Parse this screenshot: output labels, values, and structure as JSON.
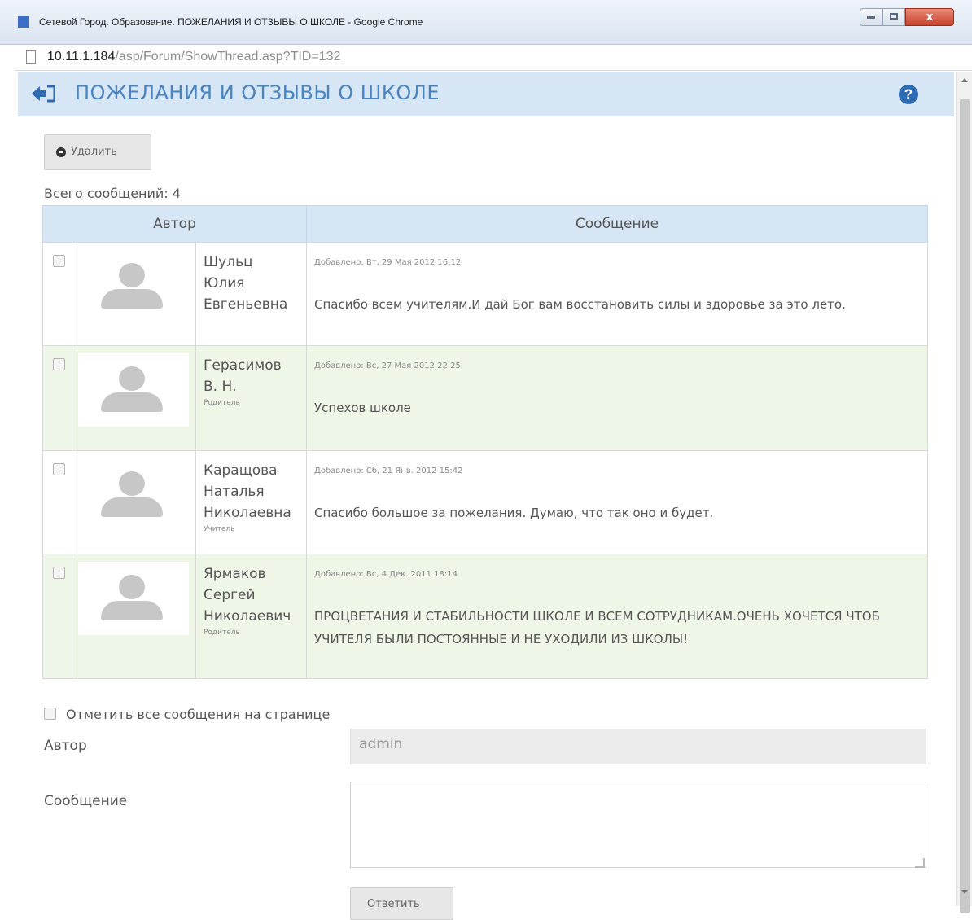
{
  "window": {
    "title": "Сетевой Город. Образование. ПОЖЕЛАНИЯ И ОТЗЫВЫ О ШКОЛЕ - Google Chrome",
    "close_label": "x"
  },
  "address": {
    "host": "10.11.1.184",
    "path": "/asp/Forum/ShowThread.asp?TID=132"
  },
  "header": {
    "title": "ПОЖЕЛАНИЯ И ОТЗЫВЫ О ШКОЛЕ",
    "help_label": "?"
  },
  "toolbar": {
    "delete_label": "Удалить"
  },
  "summary": {
    "total_label": "Всего сообщений: 4"
  },
  "table": {
    "columns": [
      "Автор",
      "Сообщение"
    ],
    "rows": [
      {
        "name_lines": [
          "Шульц",
          "Юлия",
          "Евгеньевна"
        ],
        "role": "",
        "date": "Добавлено: Вт, 29 Мая 2012 16:12",
        "message": "Спасибо всем учителям.И дай Бог вам восстановить силы и здоровье за это лето."
      },
      {
        "name_lines": [
          "Герасимов",
          "В. Н."
        ],
        "role": "Родитель",
        "date": "Добавлено: Вс, 27 Мая 2012 22:25",
        "message": "Успехов школе"
      },
      {
        "name_lines": [
          "Каращова",
          "Наталья",
          "Николаевна"
        ],
        "role": "Учитель",
        "date": "Добавлено: Сб, 21 Янв. 2012 15:42",
        "message": "Спасибо большое за пожелания. Думаю, что так оно и будет."
      },
      {
        "name_lines": [
          "Ярмаков",
          "Сергей",
          "Николаевич"
        ],
        "role": "Родитель",
        "date": "Добавлено: Вс, 4 Дек. 2011 18:14",
        "message": "ПРОЦВЕТАНИЯ И СТАБИЛЬНОСТИ ШКОЛЕ И ВСЕМ СОТРУДНИКАМ.ОЧЕНЬ ХОЧЕТСЯ ЧТОБ УЧИТЕЛЯ БЫЛИ ПОСТОЯННЫЕ И НЕ УХОДИЛИ ИЗ ШКОЛЫ!"
      }
    ]
  },
  "form": {
    "select_all_label": "Отметить все сообщения на странице",
    "author_label": "Автор",
    "author_value": "admin",
    "message_label": "Сообщение",
    "message_value": "",
    "reply_label": "Ответить"
  },
  "colors": {
    "header_bg": "#d6e6f4",
    "title_color": "#4b83bd",
    "help_icon": "#2f6bb2",
    "alt_row": "#eef6e8"
  }
}
